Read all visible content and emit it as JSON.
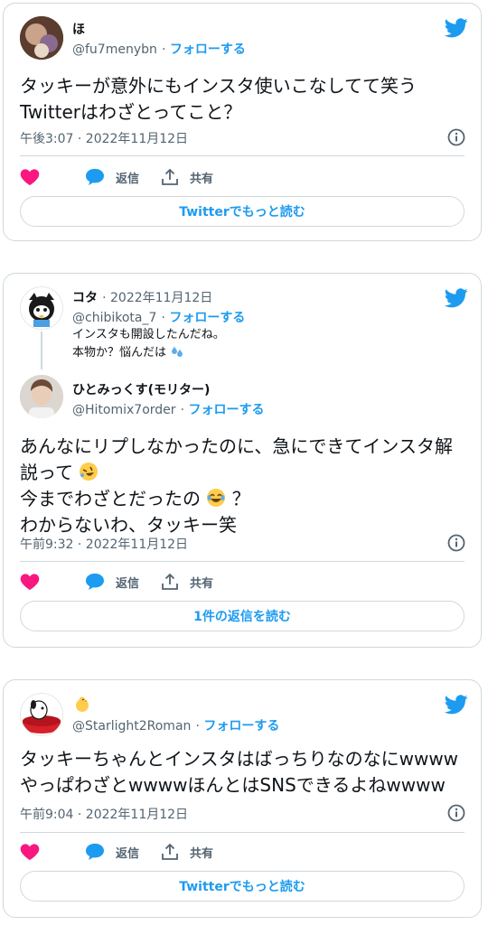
{
  "tweet1": {
    "name": "ほ",
    "handle": "@fu7menybn",
    "follow": "フォローする",
    "text_lines": [
      "タッキーが意外にもインスタ使いこなしてて笑う",
      "Twitterはわざとってこと？"
    ],
    "timestamp": "午後3:07 · 2022年11月12日",
    "reply_label": "返信",
    "share_label": "共有",
    "button_label": "Twitterでもっと読む"
  },
  "tweet2": {
    "parent": {
      "name": "コタ",
      "date": "2022年11月12日",
      "handle": "@chibikota_7",
      "follow": "フォローする",
      "text_line1": "インスタも開設したんだね。",
      "text_line2": "本物か？悩んだは"
    },
    "name": "ひとみっくす(モリター)",
    "handle": "@Hitomix7order",
    "follow": "フォローする",
    "text_lines": [
      "あんなにリプしなかったのに、急にできてインスタ解",
      "説って",
      "今までわざとだったの",
      "わからないわ、タッキー笑"
    ],
    "emoji_q": "？",
    "timestamp": "午前9:32 · 2022年11月12日",
    "reply_label": "返信",
    "share_label": "共有",
    "button_label": "1件の返信を読む"
  },
  "tweet3": {
    "name": "",
    "handle": "@Starlight2Roman",
    "follow": "フォローする",
    "text_lines": [
      "タッキーちゃんとインスタはばっちりなのなにwwww",
      "やっぱわざとwwwwほんとはSNSできるよねwwww"
    ],
    "timestamp": "午前9:04 · 2022年11月12日",
    "reply_label": "返信",
    "share_label": "共有",
    "button_label": "Twitterでもっと読む"
  },
  "icons": [
    "twitter-bird-icon",
    "info-icon",
    "heart-icon",
    "reply-bubble-icon",
    "share-icon",
    "sweat-emoji-icon",
    "rofl-emoji-icon",
    "joy-emoji-icon",
    "chick-emoji-icon"
  ],
  "colors": {
    "accent": "#1d9bf0",
    "heart": "#f91880",
    "text": "#0f1419",
    "secondary": "#536471",
    "border": "#cfd9de"
  }
}
